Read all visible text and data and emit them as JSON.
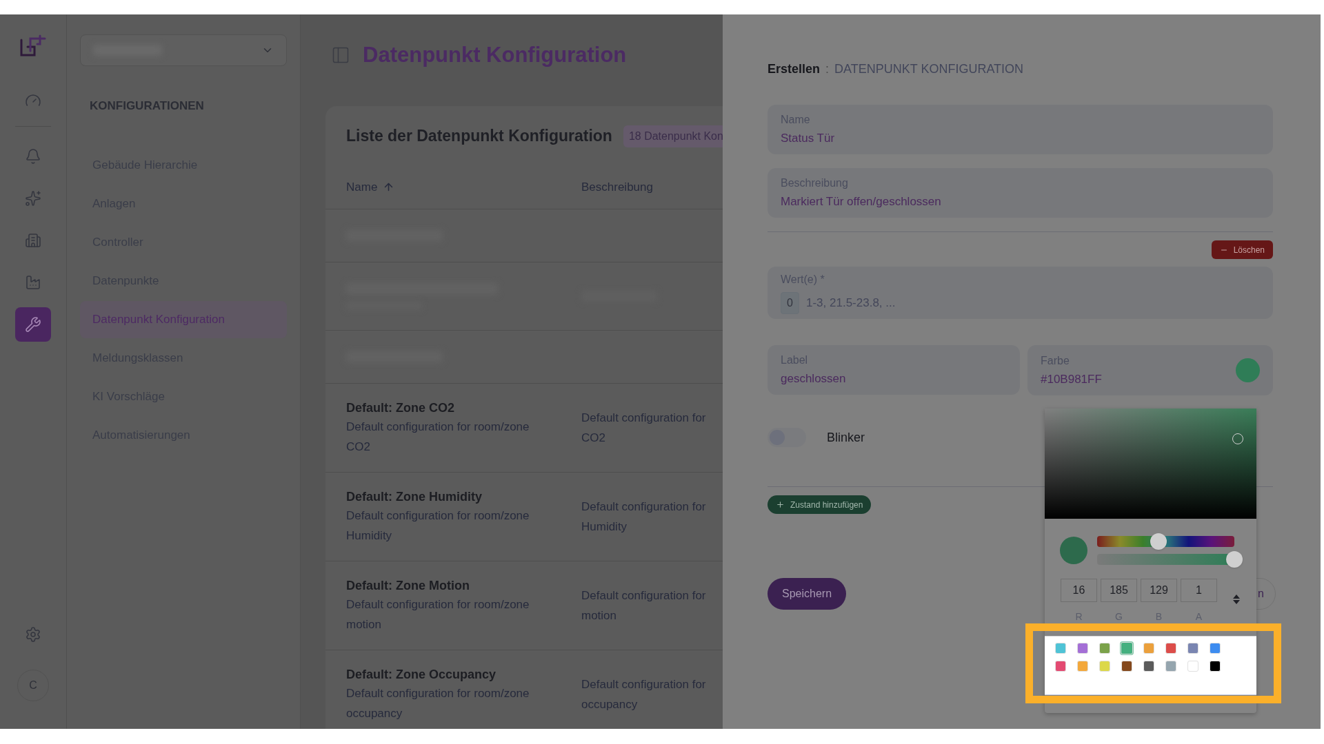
{
  "rail": {
    "top_items": [
      {
        "kind": "dashboard",
        "selected": false
      }
    ],
    "items": [
      {
        "kind": "alerts",
        "selected": false
      },
      {
        "kind": "ai",
        "selected": false
      },
      {
        "kind": "buildings",
        "selected": false
      },
      {
        "kind": "plants",
        "selected": false
      },
      {
        "kind": "config",
        "selected": true
      }
    ],
    "bottom_items": [
      {
        "kind": "settings",
        "selected": false
      }
    ],
    "avatar": "C"
  },
  "nav": {
    "heading": "KONFIGURATIONEN",
    "items": [
      {
        "label": "Gebäude Hierarchie",
        "selected": false
      },
      {
        "label": "Anlagen",
        "selected": false
      },
      {
        "label": "Controller",
        "selected": false
      },
      {
        "label": "Datenpunkte",
        "selected": false
      },
      {
        "label": "Datenpunkt Konfiguration",
        "selected": true
      },
      {
        "label": "Meldungsklassen",
        "selected": false
      },
      {
        "label": "KI Vorschläge",
        "selected": false
      },
      {
        "label": "Automatisierungen",
        "selected": false
      }
    ]
  },
  "page_title": "Datenpunkt Konfiguration",
  "list": {
    "title": "Liste der Datenpunkt Konfiguration",
    "badge": "18 Datenpunkt Kon",
    "columns": [
      {
        "label": "Name",
        "sorted": true
      },
      {
        "label": "Beschreibung",
        "sorted": false
      }
    ],
    "rows": [
      {
        "kind": "redacted"
      },
      {
        "kind": "redacted_detailed"
      },
      {
        "kind": "redacted"
      },
      {
        "kind": "entry",
        "name": "Default: Zone CO2",
        "subtitle": "Default configuration for room/zone CO2",
        "description_lines": [
          "Default configuration for",
          "CO2"
        ]
      },
      {
        "kind": "entry",
        "name": "Default: Zone Humidity",
        "subtitle": "Default configuration for room/zone Humidity",
        "description_lines": [
          "Default configuration for",
          "Humidity"
        ]
      },
      {
        "kind": "entry",
        "name": "Default: Zone Motion",
        "subtitle": "Default configuration for room/zone motion",
        "description_lines": [
          "Default configuration for",
          "motion"
        ]
      },
      {
        "kind": "entry",
        "name": "Default: Zone Occupancy",
        "subtitle": "Default configuration for room/zone occupancy",
        "description_lines": [
          "Default configuration for",
          "occupancy"
        ]
      }
    ]
  },
  "form": {
    "breadcrumb": {
      "current": "Erstellen",
      "separator": ":",
      "section": "DATENPUNKT KONFIGURATION"
    },
    "name": {
      "label": "Name",
      "value": "Status Tür"
    },
    "description": {
      "label": "Beschreibung",
      "value": "Markiert Tür offen/geschlossen"
    },
    "delete_button": "Löschen",
    "values": {
      "label": "Wert(e) *",
      "chips": [
        "0"
      ],
      "placeholder": "1-3, 21.5-23.8, ..."
    },
    "state_label": {
      "label": "Label",
      "value": "geschlossen"
    },
    "state_color": {
      "label": "Farbe",
      "value": "#10B981FF",
      "color": "#2f7d57"
    },
    "blinker": {
      "label": "Blinker",
      "on": false
    },
    "add_state_button": "Zustand hinzufügen",
    "save_button": "Speichern",
    "hidden_button": "n"
  },
  "color_picker": {
    "sliders": [
      {
        "kind": "hue",
        "level": 0.445
      },
      {
        "kind": "alpha",
        "level": 1
      }
    ],
    "channels": [
      {
        "label": "R",
        "value": "16"
      },
      {
        "label": "G",
        "value": "185"
      },
      {
        "label": "B",
        "value": "129"
      },
      {
        "label": "A",
        "value": "1"
      }
    ],
    "swatches": [
      {
        "color": "#4fc3d6",
        "selected": false
      },
      {
        "color": "#a46fd6",
        "selected": false
      },
      {
        "color": "#7ba24a",
        "selected": false
      },
      {
        "color": "#44b07f",
        "selected": true
      },
      {
        "color": "#eba03c",
        "selected": false
      },
      {
        "color": "#dc4d4a",
        "selected": false
      },
      {
        "color": "#7a85b1",
        "selected": false
      },
      {
        "color": "#3d8cf0",
        "selected": false
      },
      {
        "color": "#e34a72",
        "selected": false
      },
      {
        "color": "#f3a83b",
        "selected": false
      },
      {
        "color": "#dcd84a",
        "selected": false
      },
      {
        "color": "#84491d",
        "selected": false
      },
      {
        "color": "#5b5b5b",
        "selected": false
      },
      {
        "color": "#95a5ae",
        "selected": false
      },
      {
        "color": "#ffffff",
        "selected": false
      },
      {
        "color": "#000000",
        "selected": false
      }
    ]
  }
}
